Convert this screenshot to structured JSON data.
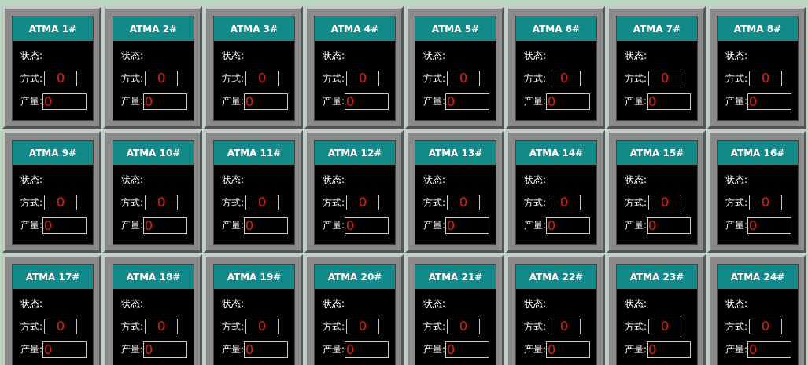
{
  "machines": [
    {
      "name": "ATMA 1#",
      "status_label": "状态:",
      "mode_label": "方式:",
      "mode_value": "0",
      "output_label": "产量:",
      "output_value": "0"
    },
    {
      "name": "ATMA 2#",
      "status_label": "状态:",
      "mode_label": "方式:",
      "mode_value": "0",
      "output_label": "产量:",
      "output_value": "0"
    },
    {
      "name": "ATMA 3#",
      "status_label": "状态:",
      "mode_label": "方式:",
      "mode_value": "0",
      "output_label": "产量:",
      "output_value": "0"
    },
    {
      "name": "ATMA 4#",
      "status_label": "状态:",
      "mode_label": "方式:",
      "mode_value": "0",
      "output_label": "产量:",
      "output_value": "0"
    },
    {
      "name": "ATMA 5#",
      "status_label": "状态:",
      "mode_label": "方式:",
      "mode_value": "0",
      "output_label": "产量:",
      "output_value": "0"
    },
    {
      "name": "ATMA 6#",
      "status_label": "状态:",
      "mode_label": "方式:",
      "mode_value": "0",
      "output_label": "产量:",
      "output_value": "0"
    },
    {
      "name": "ATMA 7#",
      "status_label": "状态:",
      "mode_label": "方式:",
      "mode_value": "0",
      "output_label": "产量:",
      "output_value": "0"
    },
    {
      "name": "ATMA 8#",
      "status_label": "状态:",
      "mode_label": "方式:",
      "mode_value": "0",
      "output_label": "产量:",
      "output_value": "0"
    },
    {
      "name": "ATMA 9#",
      "status_label": "状态:",
      "mode_label": "方式:",
      "mode_value": "0",
      "output_label": "产量:",
      "output_value": "0"
    },
    {
      "name": "ATMA 10#",
      "status_label": "状态:",
      "mode_label": "方式:",
      "mode_value": "0",
      "output_label": "产量:",
      "output_value": "0"
    },
    {
      "name": "ATMA 11#",
      "status_label": "状态:",
      "mode_label": "方式:",
      "mode_value": "0",
      "output_label": "产量:",
      "output_value": "0"
    },
    {
      "name": "ATMA 12#",
      "status_label": "状态:",
      "mode_label": "方式:",
      "mode_value": "0",
      "output_label": "产量:",
      "output_value": "0"
    },
    {
      "name": "ATMA 13#",
      "status_label": "状态:",
      "mode_label": "方式:",
      "mode_value": "0",
      "output_label": "产量:",
      "output_value": "0"
    },
    {
      "name": "ATMA 14#",
      "status_label": "状态:",
      "mode_label": "方式:",
      "mode_value": "0",
      "output_label": "产量:",
      "output_value": "0"
    },
    {
      "name": "ATMA 15#",
      "status_label": "状态:",
      "mode_label": "方式:",
      "mode_value": "0",
      "output_label": "产量:",
      "output_value": "0"
    },
    {
      "name": "ATMA 16#",
      "status_label": "状态:",
      "mode_label": "方式:",
      "mode_value": "0",
      "output_label": "产量:",
      "output_value": "0"
    },
    {
      "name": "ATMA 17#",
      "status_label": "状态:",
      "mode_label": "方式:",
      "mode_value": "0",
      "output_label": "产量:",
      "output_value": "0"
    },
    {
      "name": "ATMA 18#",
      "status_label": "状态:",
      "mode_label": "方式:",
      "mode_value": "0",
      "output_label": "产量:",
      "output_value": "0"
    },
    {
      "name": "ATMA 19#",
      "status_label": "状态:",
      "mode_label": "方式:",
      "mode_value": "0",
      "output_label": "产量:",
      "output_value": "0"
    },
    {
      "name": "ATMA 20#",
      "status_label": "状态:",
      "mode_label": "方式:",
      "mode_value": "0",
      "output_label": "产量:",
      "output_value": "0"
    },
    {
      "name": "ATMA 21#",
      "status_label": "状态:",
      "mode_label": "方式:",
      "mode_value": "0",
      "output_label": "产量:",
      "output_value": "0"
    },
    {
      "name": "ATMA 22#",
      "status_label": "状态:",
      "mode_label": "方式:",
      "mode_value": "0",
      "output_label": "产量:",
      "output_value": "0"
    },
    {
      "name": "ATMA 23#",
      "status_label": "状态:",
      "mode_label": "方式:",
      "mode_value": "0",
      "output_label": "产量:",
      "output_value": "0"
    },
    {
      "name": "ATMA 24#",
      "status_label": "状态:",
      "mode_label": "方式:",
      "mode_value": "0",
      "output_label": "产量:",
      "output_value": "0"
    }
  ]
}
